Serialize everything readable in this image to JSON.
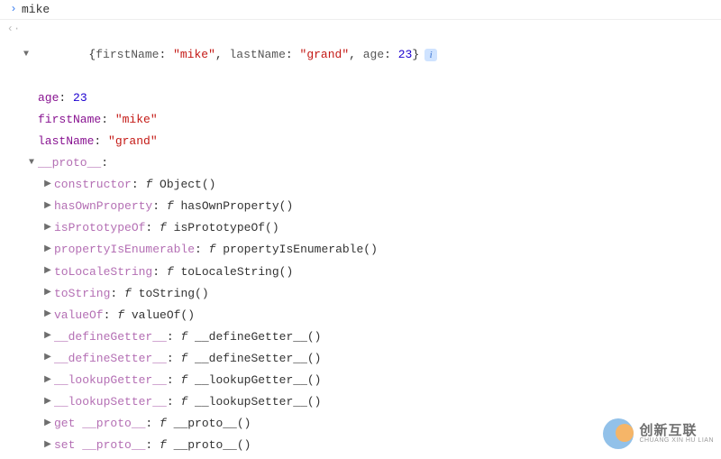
{
  "input": {
    "expr": "mike"
  },
  "summary": {
    "open_brace": "{",
    "k1": "firstName",
    "v1": "\"mike\"",
    "k2": "lastName",
    "v2": "\"grand\"",
    "k3": "age",
    "v3": "23",
    "close_brace": "}"
  },
  "own": {
    "age": {
      "key": "age",
      "val": "23"
    },
    "firstName": {
      "key": "firstName",
      "val": "\"mike\""
    },
    "lastName": {
      "key": "lastName",
      "val": "\"grand\""
    },
    "proto": {
      "key": "__proto__"
    }
  },
  "proto_methods": [
    {
      "key": "constructor",
      "fn": "Object()"
    },
    {
      "key": "hasOwnProperty",
      "fn": "hasOwnProperty()"
    },
    {
      "key": "isPrototypeOf",
      "fn": "isPrototypeOf()"
    },
    {
      "key": "propertyIsEnumerable",
      "fn": "propertyIsEnumerable()"
    },
    {
      "key": "toLocaleString",
      "fn": "toLocaleString()"
    },
    {
      "key": "toString",
      "fn": "toString()"
    },
    {
      "key": "valueOf",
      "fn": "valueOf()"
    },
    {
      "key": "__defineGetter__",
      "fn": "__defineGetter__()"
    },
    {
      "key": "__defineSetter__",
      "fn": "__defineSetter__()"
    },
    {
      "key": "__lookupGetter__",
      "fn": "__lookupGetter__()"
    },
    {
      "key": "__lookupSetter__",
      "fn": "__lookupSetter__()"
    },
    {
      "key": "get __proto__",
      "fn": "__proto__()"
    },
    {
      "key": "set __proto__",
      "fn": "__proto__()"
    }
  ],
  "glyphs": {
    "colon_sp": ": ",
    "comma_sp": ", ",
    "f_letter": "f ",
    "arrow_right": "▶",
    "arrow_down": "▼",
    "input_prompt": "›",
    "output_prompt": "‹·",
    "info": "i"
  },
  "watermark": {
    "zh": "创新互联",
    "py": "CHUANG XIN HU LIAN"
  }
}
